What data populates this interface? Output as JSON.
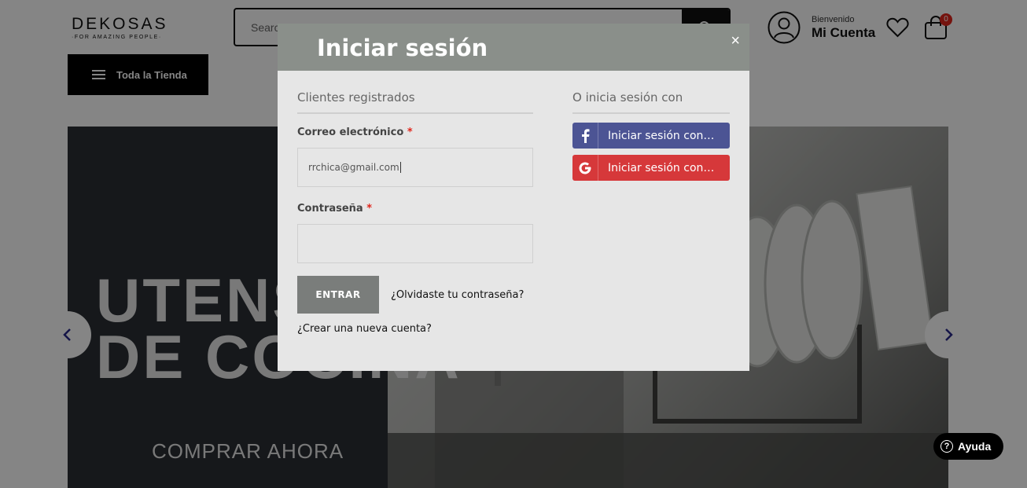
{
  "header": {
    "logo_text": "DEKOSAS",
    "logo_tagline": "·FOR AMAZING PEOPLE·",
    "search_placeholder": "Search",
    "account_greeting": "Bienvenido",
    "account_label": "Mi Cuenta",
    "cart_count": "0",
    "all_store_label": "Toda la Tienda"
  },
  "banner": {
    "title_line1": "UTENSILIOS",
    "title_line2": "DE COCINA",
    "cta": "COMPRAR AHORA"
  },
  "modal": {
    "title": "Iniciar sesión",
    "close": "×",
    "registered_title": "Clientes registrados",
    "email_label": "Correo electrónico",
    "email_value": "rrchica@gmail.com",
    "required_mark": "*",
    "password_label": "Contraseña",
    "password_value": "",
    "submit_label": "ENTRAR",
    "forgot_link": "¿Olvidaste tu contraseña?",
    "create_link": "¿Crear una nueva cuenta?",
    "social_title": "O inicia sesión con",
    "facebook_label": "Iniciar sesión con Facebook",
    "google_label": "Iniciar sesión con Google"
  },
  "help": {
    "label": "Ayuda",
    "icon_glyph": "?"
  },
  "colors": {
    "facebook": "#4c5494",
    "google": "#d6383a",
    "badge": "#e1261c",
    "modal_header": "#8a8f8a"
  }
}
